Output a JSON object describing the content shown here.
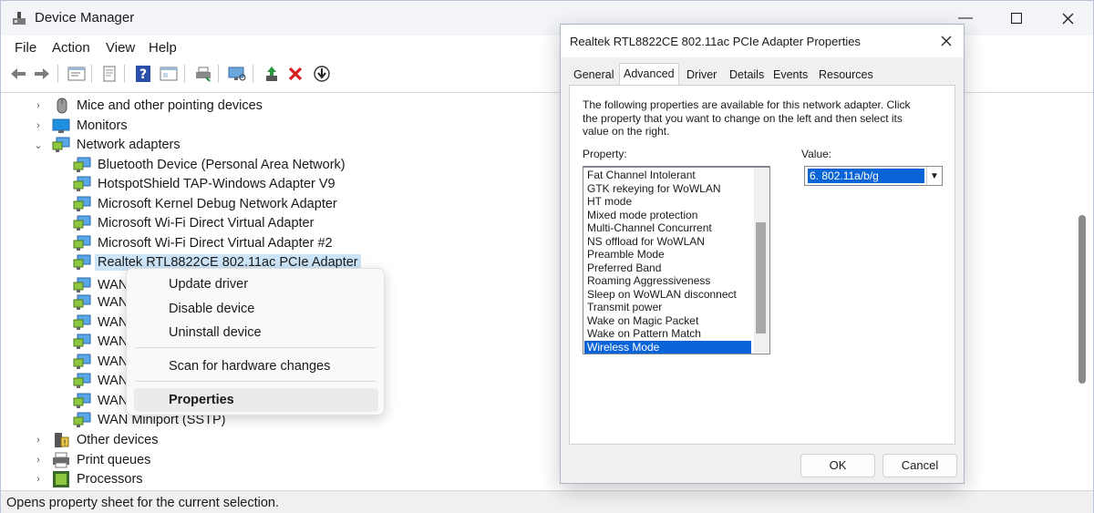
{
  "window": {
    "title": "Device Manager",
    "minimize_icon": "minimize-icon",
    "maximize_icon": "maximize-icon",
    "close_icon": "close-icon"
  },
  "menu": [
    "File",
    "Action",
    "View",
    "Help"
  ],
  "toolbar": {
    "buttons": [
      "back-arrow-icon",
      "forward-arrow-icon",
      "device-tree-icon",
      "properties-sheet-icon",
      "help-icon",
      "resources-view-icon",
      "print-icon",
      "scan-hardware-icon",
      "update-driver-icon",
      "disable-device-icon",
      "uninstall-device-icon"
    ]
  },
  "tree": {
    "nodes": [
      {
        "label": "Mice and other pointing devices",
        "expander": "›",
        "icon": "mouse-icon"
      },
      {
        "label": "Monitors",
        "expander": "›",
        "icon": "monitor-icon"
      },
      {
        "label": "Network adapters",
        "expander": "⌄",
        "icon": "network-adapter-icon"
      },
      {
        "label": "Bluetooth Device (Personal Area Network)",
        "icon": "network-adapter-icon"
      },
      {
        "label": "HotspotShield TAP-Windows Adapter V9",
        "icon": "network-adapter-icon"
      },
      {
        "label": "Microsoft Kernel Debug Network Adapter",
        "icon": "network-adapter-icon"
      },
      {
        "label": "Microsoft Wi-Fi Direct Virtual Adapter",
        "icon": "network-adapter-icon"
      },
      {
        "label": "Microsoft Wi-Fi Direct Virtual Adapter #2",
        "icon": "network-adapter-icon"
      },
      {
        "label": "Realtek RTL8822CE 802.11ac PCIe Adapter",
        "icon": "network-adapter-icon"
      },
      {
        "label": "WAN",
        "icon": "network-adapter-icon"
      },
      {
        "label": "WAN",
        "icon": "network-adapter-icon"
      },
      {
        "label": "WAN",
        "icon": "network-adapter-icon"
      },
      {
        "label": "WAN",
        "icon": "network-adapter-icon"
      },
      {
        "label": "WAN",
        "icon": "network-adapter-icon"
      },
      {
        "label": "WAN",
        "icon": "network-adapter-icon"
      },
      {
        "label": "WAN",
        "icon": "network-adapter-icon"
      },
      {
        "label": "WAN Miniport (SSTP)",
        "icon": "network-adapter-icon"
      },
      {
        "label": "Other devices",
        "expander": "›",
        "icon": "unknown-device-icon"
      },
      {
        "label": "Print queues",
        "expander": "›",
        "icon": "printer-icon"
      },
      {
        "label": "Processors",
        "expander": "›",
        "icon": "processor-icon"
      }
    ]
  },
  "context_menu": {
    "items": [
      "Update driver",
      "Disable device",
      "Uninstall device",
      "Scan for hardware changes",
      "Properties"
    ]
  },
  "status": "Opens property sheet for the current selection.",
  "dialog": {
    "title": "Realtek RTL8822CE 802.11ac PCIe Adapter Properties",
    "close_icon": "close-icon",
    "tabs": [
      "General",
      "Advanced",
      "Driver",
      "Details",
      "Events",
      "Resources"
    ],
    "active_tab": "Advanced",
    "description": "The following properties are available for this network adapter. Click the property that you want to change on the left and then select its value on the right.",
    "property_label": "Property:",
    "value_label": "Value:",
    "properties": [
      "Fat Channel Intolerant",
      "GTK rekeying for WoWLAN",
      "HT mode",
      "Mixed mode protection",
      "Multi-Channel Concurrent",
      "NS offload for WoWLAN",
      "Preamble Mode",
      "Preferred Band",
      "Roaming Aggressiveness",
      "Sleep on WoWLAN disconnect",
      "Transmit power",
      "Wake on Magic Packet",
      "Wake on Pattern Match",
      "Wireless Mode"
    ],
    "selected_property": "Wireless Mode",
    "value": "6. 802.11a/b/g",
    "ok": "OK",
    "cancel": "Cancel"
  },
  "colors": {
    "selection": "#0a64d8",
    "tree_selection": "#cce4f7",
    "uninstall_red": "#d42020"
  }
}
